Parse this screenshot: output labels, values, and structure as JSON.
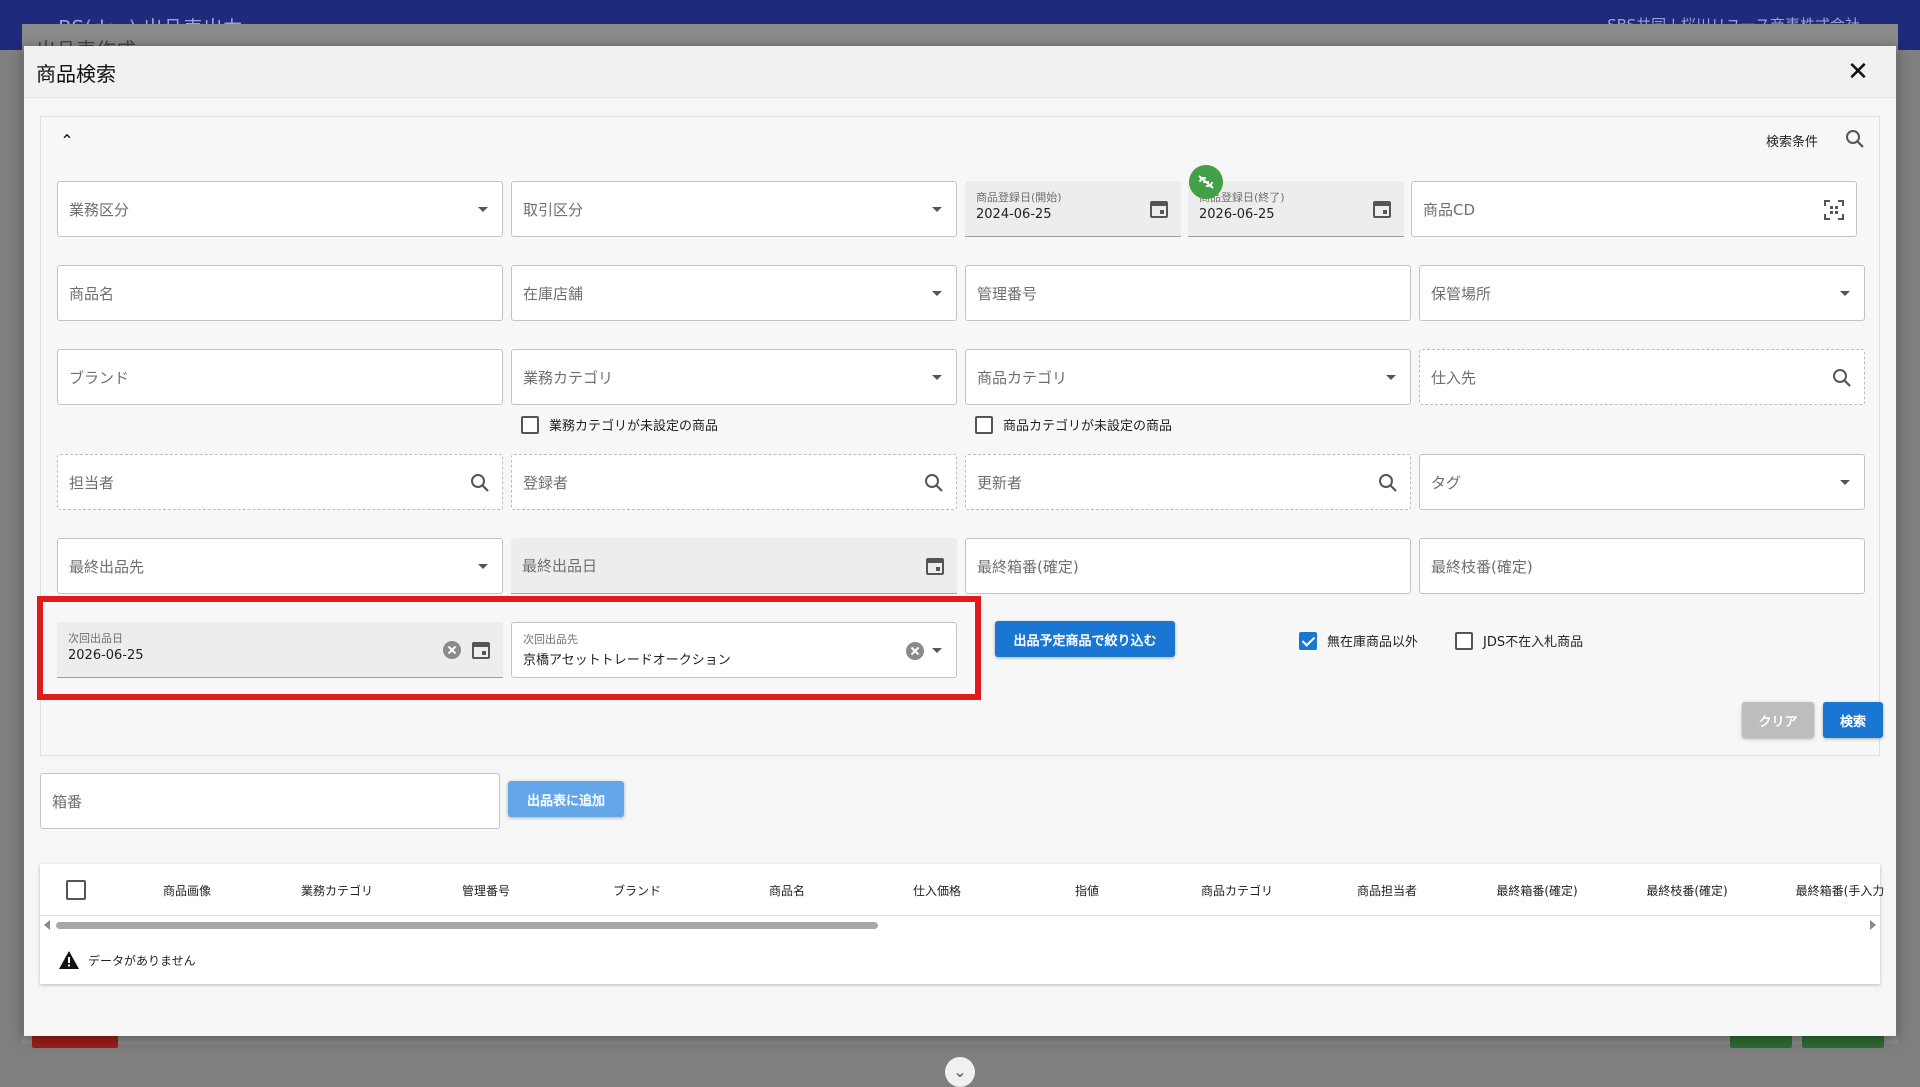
{
  "background": {
    "app_title": "BS(dev) 出品表出力",
    "user_name": "SBS共同 | 桜川リユース商事株式会社",
    "dialog_title": "出品表作成"
  },
  "modal": {
    "title": "商品検索"
  },
  "panel": {
    "search_conditions_label": "検索条件",
    "fields": {
      "gyomu_kubun": "業務区分",
      "torihiki_kubun": "取引区分",
      "reg_start_label": "商品登録日(開始)",
      "reg_start_value": "2024-06-25",
      "reg_end_label": "商品登録日(終了)",
      "reg_end_value": "2026-06-25",
      "shohin_cd": "商品CD",
      "shohin_mei": "商品名",
      "zaiko_tenpo": "在庫店舗",
      "kanri_bango": "管理番号",
      "hokan_basho": "保管場所",
      "brand": "ブランド",
      "gyomu_category": "業務カテゴリ",
      "shohin_category": "商品カテゴリ",
      "shiiresaki": "仕入先",
      "tantosha": "担当者",
      "torokusha": "登録者",
      "koshinsha": "更新者",
      "tag": "タグ",
      "saishu_shuppinsaki": "最終出品先",
      "saishu_shuppinbi": "最終出品日",
      "saishu_hakoban": "最終箱番(確定)",
      "saishu_edaban": "最終枝番(確定)",
      "jikai_shuppinbi_label": "次回出品日",
      "jikai_shuppinbi_value": "2026-06-25",
      "jikai_shuppinsaki_label": "次回出品先",
      "jikai_shuppinsaki_value": "京橋アセットトレードオークション"
    },
    "checkboxes": {
      "gyomu_category_unset": "業務カテゴリが未設定の商品",
      "shohin_category_unset": "商品カテゴリが未設定の商品",
      "except_no_stock": "無在庫商品以外",
      "jds_absent": "JDS不在入札商品"
    },
    "buttons": {
      "filter_scheduled": "出品予定商品で絞り込む",
      "clear": "クリア",
      "search": "検索"
    }
  },
  "box_number": {
    "placeholder": "箱番",
    "add_button": "出品表に追加"
  },
  "table": {
    "columns": [
      "商品画像",
      "業務カテゴリ",
      "管理番号",
      "ブランド",
      "商品名",
      "仕入価格",
      "指値",
      "商品カテゴリ",
      "商品担当者",
      "最終箱番(確定)",
      "最終枝番(確定)",
      "最終箱番(手入力"
    ],
    "empty_message": "データがありません"
  },
  "colors": {
    "primary": "#1976d2",
    "highlight": "#e01b1b",
    "badge": "#43a047"
  }
}
